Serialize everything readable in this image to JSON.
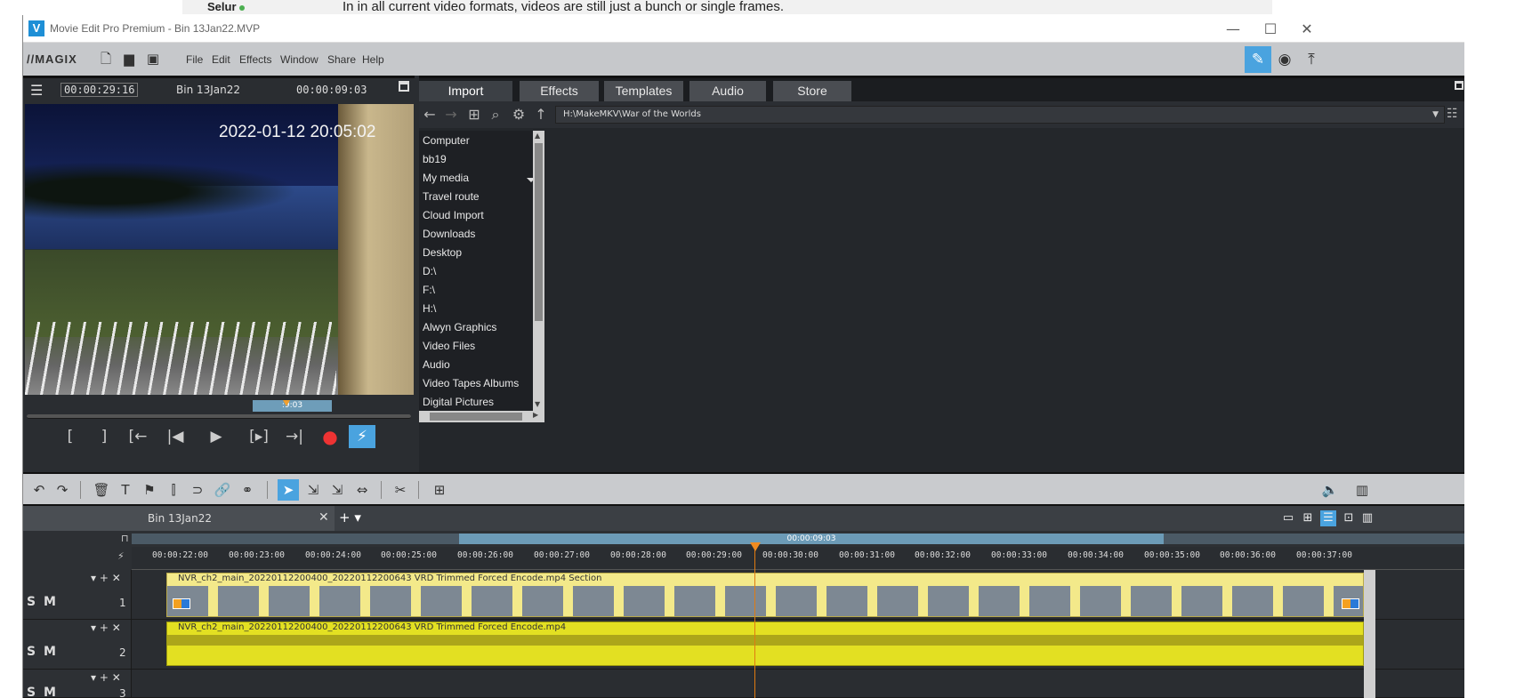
{
  "background_page": {
    "user": "Selur",
    "message": "In in all current video formats, videos are still just a bunch or single frames."
  },
  "window": {
    "app_icon_letter": "V",
    "title": "Movie Edit Pro Premium - Bin 13Jan22.MVP",
    "controls": {
      "minimize": "—",
      "maximize": "☐",
      "close": "✕"
    }
  },
  "menubar": {
    "logo": "//MAGIX",
    "items": [
      "File",
      "Edit",
      "Effects",
      "Window",
      "Share",
      "Help"
    ]
  },
  "preview": {
    "timecode_position": "00:00:29:16",
    "project_name": "Bin 13Jan22",
    "timecode_duration": "00:00:09:03",
    "video_timestamp": "2022-01-12 20:05:02",
    "scrub_label": ":9:03",
    "transport": [
      "[",
      "]",
      "[←",
      "|◀",
      "▶",
      "[▸]",
      "→|",
      "●",
      "⚡"
    ]
  },
  "pool": {
    "tabs": [
      "Import",
      "Effects",
      "Templates",
      "Audio",
      "Store"
    ],
    "selected_tab": "Import",
    "path": "H:\\MakeMKV\\War of the Worlds",
    "tree": [
      "Computer",
      "bb19",
      "My media",
      "Travel route",
      "Cloud Import",
      "Downloads",
      "Desktop",
      "D:\\",
      "F:\\",
      "H:\\",
      "Alwyn Graphics",
      "Video Files",
      "Audio",
      "Video Tapes Albums",
      "Digital Pictures"
    ]
  },
  "timeline": {
    "project_tab": "Bin 13Jan22",
    "range_label": "00:00:09:03",
    "ruler_ticks": [
      "00:00:22:00",
      "00:00:23:00",
      "00:00:24:00",
      "00:00:25:00",
      "00:00:26:00",
      "00:00:27:00",
      "00:00:28:00",
      "00:00:29:00",
      "00:00:30:00",
      "00:00:31:00",
      "00:00:32:00",
      "00:00:33:00",
      "00:00:34:00",
      "00:00:35:00",
      "00:00:36:00",
      "00:00:37:00"
    ],
    "track_buttons": "S M",
    "tracks": [
      {
        "number": "1",
        "clip": "NVR_ch2_main_20220112200400_20220112200643 VRD Trimmed Forced Encode.mp4   Section"
      },
      {
        "number": "2",
        "clip": "NVR_ch2_main_20220112200400_20220112200643 VRD Trimmed Forced Encode.mp4"
      },
      {
        "number": "3"
      }
    ]
  }
}
